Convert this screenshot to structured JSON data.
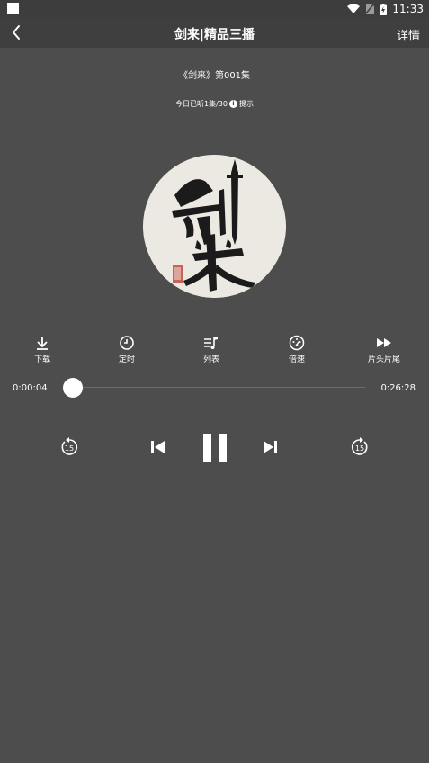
{
  "status_bar": {
    "time": "11:33"
  },
  "header": {
    "title": "剑来|精品三播",
    "detail_label": "详情"
  },
  "episode": {
    "title": "《剑来》第001集",
    "daily_limit_text": "今日已听1集/30",
    "hint_label": "提示"
  },
  "functions": [
    {
      "icon": "download-icon",
      "label": "下载"
    },
    {
      "icon": "timer-icon",
      "label": "定时"
    },
    {
      "icon": "playlist-icon",
      "label": "列表"
    },
    {
      "icon": "speed-icon",
      "label": "倍速"
    },
    {
      "icon": "skip-intro-outro-icon",
      "label": "片头片尾"
    }
  ],
  "progress": {
    "current_time": "0:00:04",
    "total_time": "0:26:28",
    "fraction": 0.0025
  },
  "controls": {
    "rewind_seconds": "15",
    "forward_seconds": "15"
  },
  "colors": {
    "background": "#4d4d4d",
    "header": "#3f3f3f",
    "status_bar": "#3d3d3d",
    "foreground": "#ffffff"
  }
}
